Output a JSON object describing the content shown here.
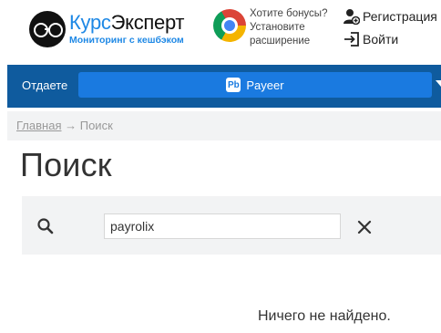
{
  "header": {
    "brand_part1": "Курс",
    "brand_part2": "Эксперт",
    "tagline": "Мониторинг с кешбэком",
    "promo": {
      "line1": "Хотите бонусы?",
      "line2": "Установите",
      "line3": "расширение"
    },
    "register_label": "Регистрация",
    "login_label": "Войти"
  },
  "exchange_bar": {
    "give_label": "Отдаете",
    "currency_badge": "Pb",
    "currency_name": "Payeer"
  },
  "breadcrumb": {
    "home": "Главная",
    "separator": "→",
    "current": "Поиск"
  },
  "page_title": "Поиск",
  "search": {
    "query": "payrolix"
  },
  "results": {
    "empty_message": "Ничего не найдено."
  },
  "colors": {
    "accent_blue": "#1e88e5",
    "bar_blue": "#0f5b9e",
    "select_blue": "#1a7ae0",
    "panel_gray": "#f2f3f4"
  }
}
